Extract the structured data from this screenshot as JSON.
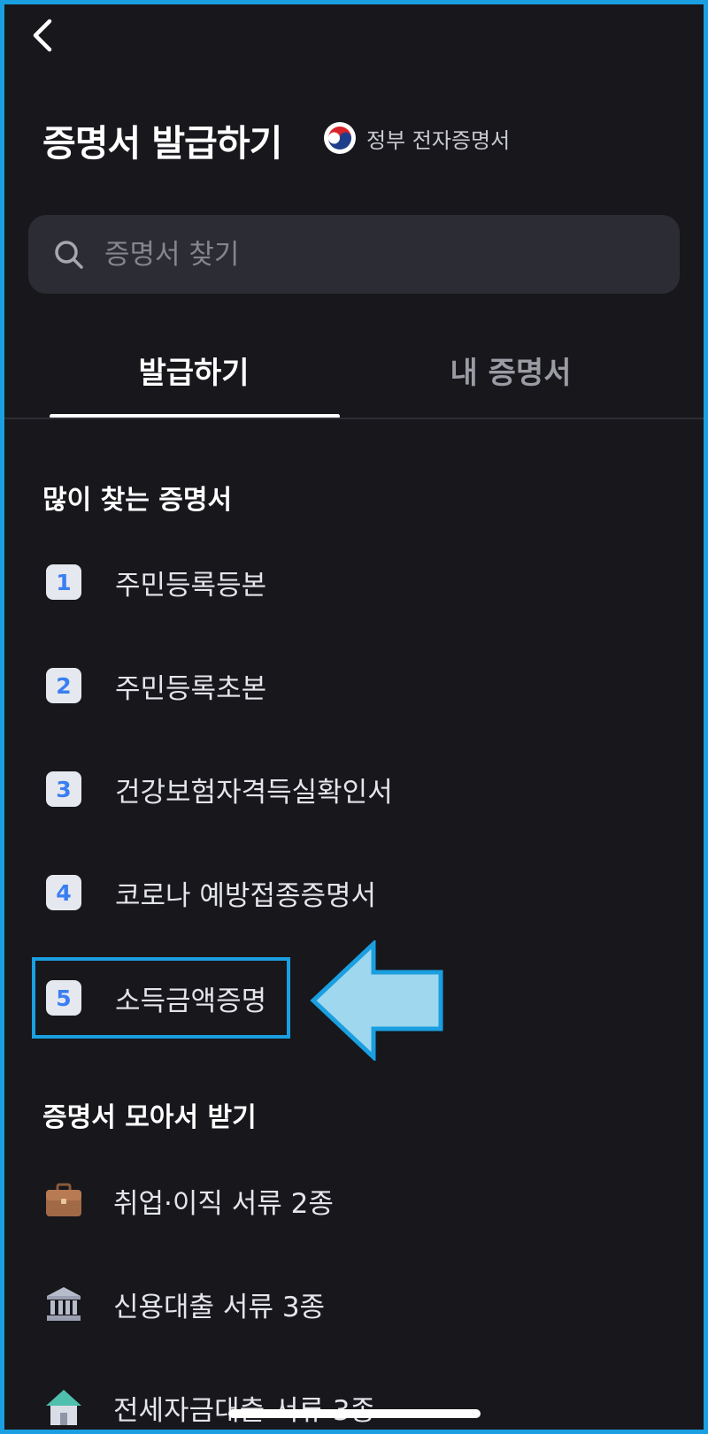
{
  "header": {
    "title": "증명서 발급하기",
    "gov_badge_label": "정부 전자증명서"
  },
  "search": {
    "placeholder": "증명서 찾기"
  },
  "tabs": [
    {
      "label": "발급하기",
      "active": true
    },
    {
      "label": "내 증명서",
      "active": false
    }
  ],
  "popular": {
    "title": "많이 찾는 증명서",
    "items": [
      {
        "rank": "1",
        "label": "주민등록등본"
      },
      {
        "rank": "2",
        "label": "주민등록초본"
      },
      {
        "rank": "3",
        "label": "건강보험자격득실확인서"
      },
      {
        "rank": "4",
        "label": "코로나 예방접종증명서"
      },
      {
        "rank": "5",
        "label": "소득금액증명"
      }
    ]
  },
  "bundles": {
    "title": "증명서 모아서 받기",
    "items": [
      {
        "icon": "briefcase-icon",
        "label": "취업·이직 서류 2종"
      },
      {
        "icon": "bank-icon",
        "label": "신용대출 서류 3종"
      },
      {
        "icon": "house-icon",
        "label": "전세자금대출 서류 3종"
      }
    ]
  },
  "colors": {
    "background": "#17171c",
    "accent_blue": "#3a7ef2",
    "highlight_annotation": "#1a9fe0",
    "arrow_fill": "#9ed7ee",
    "search_bg": "#2c2d34"
  }
}
